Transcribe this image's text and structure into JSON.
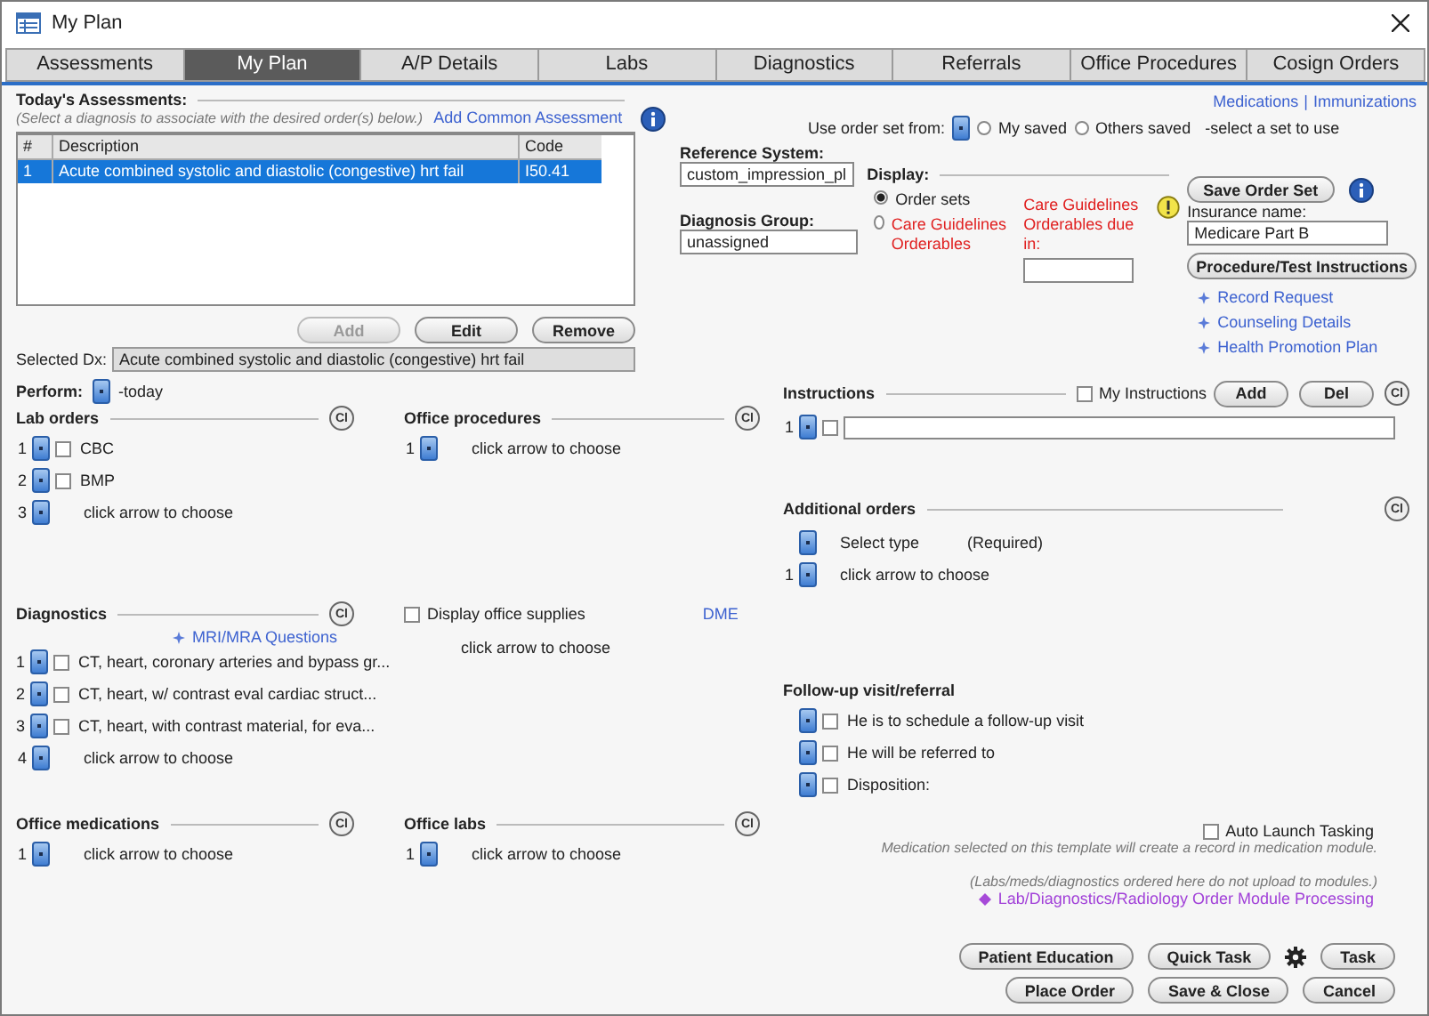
{
  "window": {
    "title": "My Plan"
  },
  "tabs": [
    {
      "label": "Assessments",
      "selected": false
    },
    {
      "label": "My Plan",
      "selected": true
    },
    {
      "label": "A/P Details",
      "selected": false
    },
    {
      "label": "Labs",
      "selected": false
    },
    {
      "label": "Diagnostics",
      "selected": false
    },
    {
      "label": "Referrals",
      "selected": false
    },
    {
      "label": "Office Procedures",
      "selected": false
    },
    {
      "label": "Cosign Orders",
      "selected": false
    }
  ],
  "assessments": {
    "title": "Today's Assessments:",
    "hint": "(Select a diagnosis to associate with the desired order(s) below.)",
    "add_link": "Add Common Assessment",
    "columns": [
      "#",
      "Description",
      "Code"
    ],
    "rows": [
      {
        "number": "1",
        "description": "Acute combined systolic and diastolic (congestive) hrt fail",
        "code": "I50.41",
        "selected": true
      }
    ],
    "buttons": [
      {
        "label": "Add",
        "disabled": true
      },
      {
        "label": "Edit",
        "disabled": false
      },
      {
        "label": "Remove",
        "disabled": false
      }
    ],
    "selected_dx": {
      "label": "Selected Dx:",
      "value": "Acute combined systolic and diastolic (congestive) hrt fail"
    }
  },
  "top_links": {
    "items": [
      "Medications",
      "Immunizations"
    ],
    "separator": "|"
  },
  "order_set": {
    "label": "Use order set from:",
    "options": [
      {
        "label": "My saved",
        "selected": false
      },
      {
        "label": "Others saved",
        "selected": false
      }
    ],
    "hint": "-select a set to use"
  },
  "reference_system": {
    "label": "Reference System:",
    "value": "custom_impression_pl"
  },
  "diagnosis_group": {
    "label": "Diagnosis Group:",
    "value": "unassigned"
  },
  "display": {
    "label": "Display:",
    "options": [
      {
        "label": "Order sets",
        "selected": true,
        "alert": false
      },
      {
        "label": "Care Guidelines Orderables",
        "selected": false,
        "alert": true
      }
    ]
  },
  "care_guidelines_due": {
    "label": "Care Guidelines Orderables due in:"
  },
  "save_order_set": "Save Order Set",
  "insurance": {
    "label": "Insurance name:",
    "value": "Medicare Part B"
  },
  "procedure_button": "Procedure/Test Instructions",
  "side_links": [
    "Record Request",
    "Counseling Details",
    "Health Promotion Plan"
  ],
  "perform": {
    "label": "Perform:",
    "value": "-today"
  },
  "lab_orders": {
    "title": "Lab orders",
    "clear": "Cl",
    "rows": [
      {
        "number": "1",
        "kind": "item",
        "text": "CBC",
        "checked": false
      },
      {
        "number": "2",
        "kind": "item",
        "text": "BMP",
        "checked": false
      },
      {
        "number": "3",
        "kind": "empty",
        "text": "click arrow to choose"
      }
    ]
  },
  "office_procedures": {
    "title": "Office procedures",
    "clear": "Cl",
    "rows": [
      {
        "number": "1",
        "kind": "empty",
        "text": "click arrow to choose"
      }
    ]
  },
  "diagnostics": {
    "title": "Diagnostics",
    "clear": "Cl",
    "link": "MRI/MRA Questions",
    "rows": [
      {
        "number": "1",
        "kind": "item",
        "text": "CT, heart, coronary arteries and bypass gr...",
        "checked": false
      },
      {
        "number": "2",
        "kind": "item",
        "text": "CT, heart, w/ contrast eval cardiac struct...",
        "checked": false
      },
      {
        "number": "3",
        "kind": "item",
        "text": "CT, heart, with contrast material, for eva...",
        "checked": false
      },
      {
        "number": "4",
        "kind": "empty",
        "text": "click arrow to choose"
      }
    ]
  },
  "office_supplies": {
    "label": "Display office supplies",
    "checked": false,
    "link": "DME",
    "rows": [
      {
        "kind": "plain",
        "text": "click arrow to choose"
      }
    ]
  },
  "office_medications": {
    "title": "Office medications",
    "clear": "Cl",
    "rows": [
      {
        "number": "1",
        "kind": "empty",
        "text": "click arrow to choose"
      }
    ]
  },
  "office_labs": {
    "title": "Office labs",
    "clear": "Cl",
    "rows": [
      {
        "number": "1",
        "kind": "empty",
        "text": "click arrow to choose"
      }
    ]
  },
  "instructions": {
    "title": "Instructions",
    "my_instructions": {
      "label": "My Instructions",
      "checked": false
    },
    "buttons": [
      "Add",
      "Del"
    ],
    "clear": "Cl",
    "rows": [
      {
        "number": "1",
        "checked": false
      }
    ]
  },
  "additional_orders": {
    "title": "Additional orders",
    "clear": "Cl",
    "type": {
      "label": "Select type",
      "note": "(Required)"
    },
    "rows": [
      {
        "number": "1",
        "kind": "empty",
        "text": "click arrow to choose"
      }
    ]
  },
  "follow_up": {
    "title": "Follow-up visit/referral",
    "rows": [
      {
        "kind": "item",
        "text": "He is to schedule a follow-up visit",
        "checked": false
      },
      {
        "kind": "item",
        "text": "He will be referred to",
        "checked": false
      },
      {
        "kind": "item",
        "text": "Disposition:",
        "checked": false
      }
    ]
  },
  "auto_launch": {
    "label": "Auto Launch Tasking",
    "checked": false
  },
  "notes": [
    "Medication selected on this template will create a record in medication module.",
    "(Labs/meds/diagnostics ordered here do not upload to modules.)"
  ],
  "module_link": "Lab/Diagnostics/Radiology Order Module Processing",
  "action_rows": [
    [
      {
        "kind": "button",
        "label": "Patient Education"
      },
      {
        "kind": "button",
        "label": "Quick Task"
      },
      {
        "kind": "gear"
      },
      {
        "kind": "button",
        "label": "Task"
      }
    ],
    [
      {
        "kind": "button",
        "label": "Place Order"
      },
      {
        "kind": "button",
        "label": "Save & Close"
      },
      {
        "kind": "button",
        "label": "Cancel"
      }
    ]
  ]
}
